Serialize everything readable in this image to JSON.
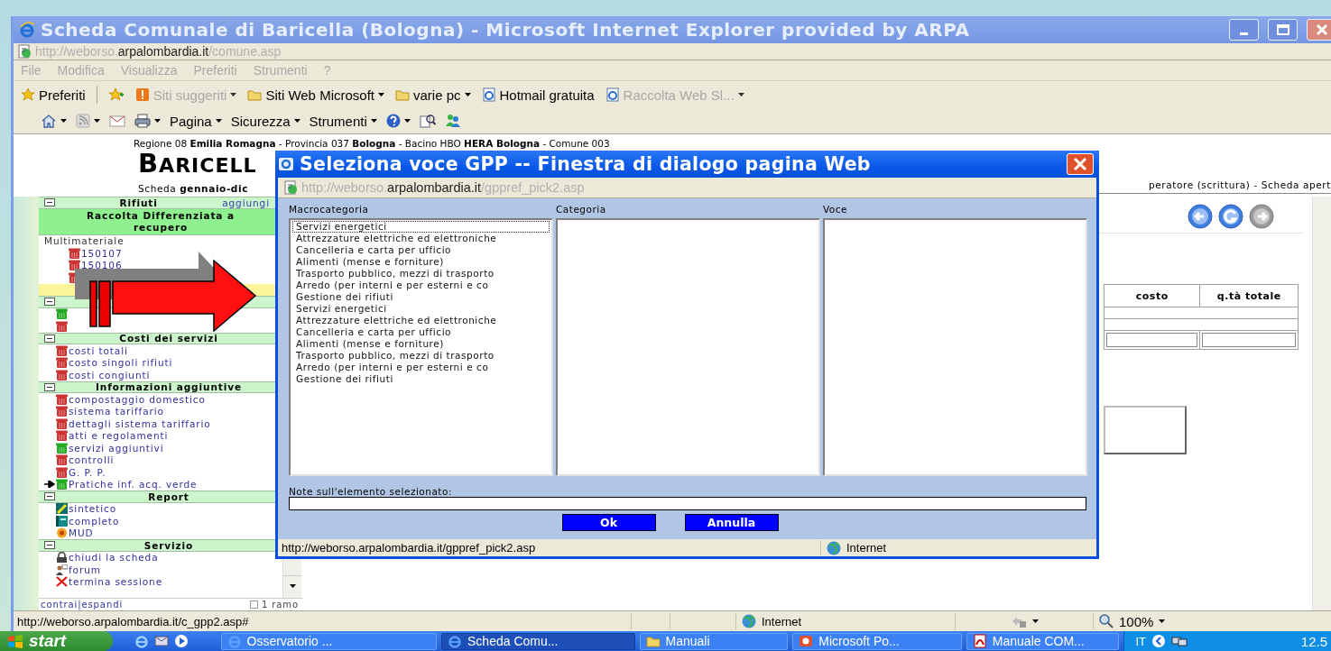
{
  "window": {
    "title": "Scheda Comunale di Baricella (Bologna) - Microsoft Internet Explorer provided by ARPA"
  },
  "address_bar": {
    "url_parts": [
      {
        "text": "http://weborso.",
        "dim": true
      },
      {
        "text": "arpalombardia.it",
        "dim": false
      },
      {
        "text": "/comune.asp",
        "dim": true
      }
    ]
  },
  "menu_bar": [
    "File",
    "Modifica",
    "Visualizza",
    "Preferiti",
    "Strumenti",
    "?"
  ],
  "favorites_bar": [
    {
      "kind": "favorites",
      "label": "Preferiti",
      "dropdown": false,
      "disabled": false
    },
    {
      "kind": "add",
      "dropdown": false,
      "disabled": false
    },
    {
      "kind": "suggested",
      "label": "Siti suggeriti",
      "dropdown": true,
      "disabled": true
    },
    {
      "kind": "folder",
      "label": "Siti Web Microsoft",
      "dropdown": true,
      "disabled": false
    },
    {
      "kind": "folder",
      "label": "varie pc",
      "dropdown": true,
      "disabled": false
    },
    {
      "kind": "page",
      "label": "Hotmail gratuita",
      "dropdown": false,
      "disabled": false
    },
    {
      "kind": "page",
      "label": "Raccolta Web Sl...",
      "dropdown": true,
      "disabled": true
    }
  ],
  "command_bar": [
    {
      "kind": "home",
      "dropdown": true
    },
    {
      "kind": "feed",
      "dropdown": true
    },
    {
      "kind": "mail",
      "dropdown": false
    },
    {
      "kind": "print",
      "dropdown": true
    },
    {
      "kind": "menu",
      "label": "Pagina",
      "dropdown": true
    },
    {
      "kind": "menu",
      "label": "Sicurezza",
      "dropdown": true
    },
    {
      "kind": "menu",
      "label": "Strumenti",
      "dropdown": true
    },
    {
      "kind": "help",
      "dropdown": true
    },
    {
      "kind": "research",
      "dropdown": false
    },
    {
      "kind": "messenger",
      "dropdown": false
    }
  ],
  "page": {
    "location_line": "Regione 08 **Emilia Romagna** - Provincia 037 **Bologna** - Bacino HBO **HERA Bologna** - Comune 003",
    "heading": "BARICELL",
    "subheading": "Scheda **gennaio-dic**",
    "status_line": "peratore (scrittura) - Scheda apert"
  },
  "sidebar": {
    "sections": [
      {
        "title": "Rifiuti",
        "action": "aggiungi",
        "expanded": true,
        "children": [
          {
            "kind": "subheader",
            "text": "Raccolta Differenziata a recupero"
          },
          {
            "kind": "group",
            "text": "Multimateriale",
            "children": [
              {
                "kind": "bin",
                "color": "#cc3333",
                "text": "150107",
                "current": false
              },
              {
                "kind": "bin",
                "color": "#cc3333",
                "text": "150106",
                "current": false
              },
              {
                "kind": "bin",
                "color": "#cc3333",
                "current": false
              }
            ]
          },
          {
            "kind": "highlight"
          }
        ]
      },
      {
        "expanded": true,
        "children": [
          {
            "kind": "bin",
            "color": "#22aa22",
            "current": false
          },
          {
            "kind": "bin",
            "color": "#cc3333",
            "current": false
          }
        ]
      },
      {
        "title": "Costi dei servizi",
        "expanded": true,
        "children": [
          {
            "kind": "bin",
            "color": "#cc3333",
            "text": "costi totali",
            "current": false
          },
          {
            "kind": "bin",
            "color": "#cc3333",
            "text": "costo singoli rifiuti",
            "current": false
          },
          {
            "kind": "bin",
            "color": "#cc3333",
            "text": "costi congiunti",
            "current": false
          }
        ]
      },
      {
        "title": "Informazioni aggiuntive",
        "expanded": true,
        "children": [
          {
            "kind": "bin",
            "color": "#cc3333",
            "text": "compostaggio domestico",
            "current": false
          },
          {
            "kind": "bin",
            "color": "#cc3333",
            "text": "sistema tariffario",
            "current": false
          },
          {
            "kind": "bin",
            "color": "#cc3333",
            "text": "dettagli sistema tariffario",
            "current": false
          },
          {
            "kind": "bin",
            "color": "#cc3333",
            "text": "atti e regolamenti",
            "current": false
          },
          {
            "kind": "bin",
            "color": "#22aa22",
            "text": "servizi aggiuntivi",
            "current": false
          },
          {
            "kind": "bin",
            "color": "#cc3333",
            "text": "controlli",
            "current": false
          },
          {
            "kind": "bin",
            "color": "#cc3333",
            "text": "G. P. P.",
            "current": false
          },
          {
            "kind": "bin",
            "color": "#22aa22",
            "text": "Pratiche inf. acq. verde",
            "current": true
          }
        ]
      },
      {
        "title": "Report",
        "expanded": true,
        "children": [
          {
            "kind": "report",
            "text": "sintetico",
            "current": false
          },
          {
            "kind": "book",
            "text": "completo",
            "current": false
          },
          {
            "kind": "flower",
            "text": "MUD",
            "current": false
          }
        ]
      },
      {
        "title": "Servizio",
        "expanded": true,
        "children": [
          {
            "kind": "lock",
            "text": "chiudi la scheda",
            "current": false
          },
          {
            "kind": "forum",
            "text": "forum",
            "current": false
          },
          {
            "kind": "exit",
            "text": "termina sessione",
            "current": false
          }
        ]
      }
    ],
    "footer": {
      "link": "contrai|espandi",
      "checkbox": {
        "label": "1 ramo",
        "checked": false
      }
    }
  },
  "content": {
    "nav_buttons": [
      {
        "kind": "back",
        "disabled": false
      },
      {
        "kind": "refresh",
        "disabled": false
      },
      {
        "kind": "forward",
        "disabled": true
      }
    ],
    "table": {
      "columns": [
        "costo",
        "q.tà totale"
      ]
    }
  },
  "status_bar": {
    "url": "http://weborso.arpalombardia.it/c_gpp2.asp#",
    "zone": "Internet",
    "zoom": "100%"
  },
  "dialog": {
    "title": "Seleziona voce GPP -- Finestra di dialogo pagina Web",
    "url_parts": [
      {
        "text": "http://weborso.",
        "dim": true
      },
      {
        "text": "arpalombardia.it",
        "dim": false
      },
      {
        "text": "/gppref_pick2.asp",
        "dim": true
      }
    ],
    "lists": [
      {
        "label": "Macrocategoria",
        "items": [
          {
            "text": "Servizi energetici",
            "focused": true
          },
          {
            "text": "Attrezzature elettriche ed elettroniche",
            "focused": false
          },
          {
            "text": "Cancelleria e carta per ufficio",
            "focused": false
          },
          {
            "text": "Alimenti (mense e forniture)",
            "focused": false
          },
          {
            "text": "Trasporto pubblico, mezzi di trasporto",
            "focused": false
          },
          {
            "text": "Arredo (per interni e per esterni e co",
            "focused": false
          },
          {
            "text": "Gestione dei rifiuti",
            "focused": false
          },
          {
            "text": "Servizi energetici",
            "focused": false
          },
          {
            "text": "Attrezzature elettriche ed elettroniche",
            "focused": false
          },
          {
            "text": "Cancelleria e carta per ufficio",
            "focused": false
          },
          {
            "text": "Alimenti (mense e forniture)",
            "focused": false
          },
          {
            "text": "Trasporto pubblico, mezzi di trasporto",
            "focused": false
          },
          {
            "text": "Arredo (per interni e per esterni e co",
            "focused": false
          },
          {
            "text": "Gestione dei rifiuti",
            "focused": false
          }
        ]
      },
      {
        "label": "Categoria"
      },
      {
        "label": "Voce"
      }
    ],
    "notes_label": "Note sull'elemento selezionato:",
    "buttons": [
      "Ok",
      "Annulla"
    ],
    "status_bar": {
      "url": "http://weborso.arpalombardia.it/gppref_pick2.asp",
      "zone": "Internet"
    }
  },
  "taskbar": {
    "start": "start",
    "tasks": [
      {
        "kind": "browser",
        "label": "Osservatorio ...",
        "selected": false
      },
      {
        "kind": "browser",
        "label": "Scheda Comu...",
        "selected": true
      },
      {
        "kind": "folder",
        "label": "Manuali",
        "selected": false
      },
      {
        "kind": "slides",
        "label": "Microsoft Po...",
        "selected": false
      },
      {
        "kind": "pdf",
        "label": "Manuale COM...",
        "selected": false
      }
    ],
    "language": "IT",
    "clock": "12.5"
  }
}
